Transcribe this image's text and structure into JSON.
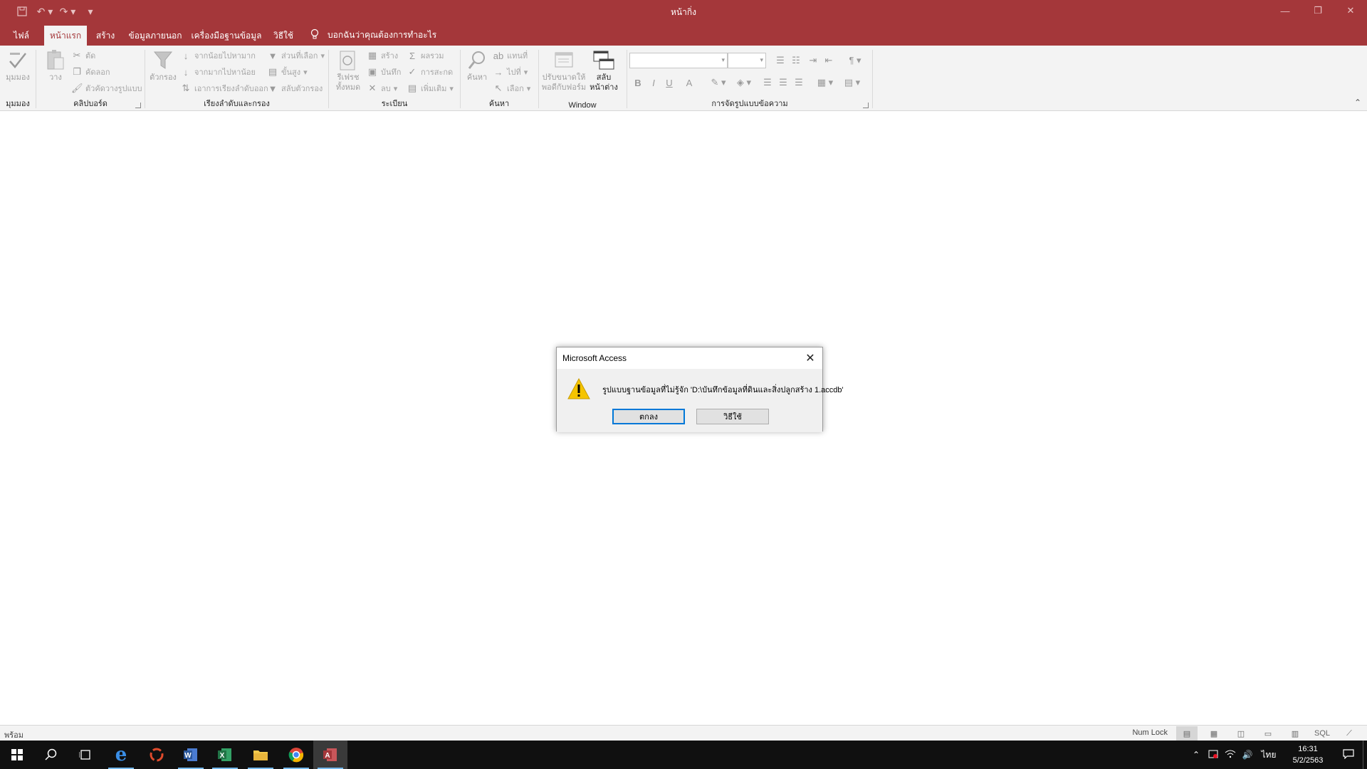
{
  "window": {
    "title": "หน้ากิ่ง",
    "quick_access": [
      "save-icon",
      "undo-icon",
      "redo-icon",
      "customize-icon"
    ],
    "controls": [
      "minimize-icon",
      "restore-icon",
      "close-icon"
    ]
  },
  "tabs": [
    {
      "label": "ไฟล์"
    },
    {
      "label": "หน้าแรก"
    },
    {
      "label": "สร้าง"
    },
    {
      "label": "ข้อมูลภายนอก"
    },
    {
      "label": "เครื่องมือฐานข้อมูล"
    },
    {
      "label": "วิธีใช้"
    }
  ],
  "tell_me": "บอกฉันว่าคุณต้องการทำอะไร",
  "ribbon": {
    "views": {
      "group": "มุมมอง",
      "view_label": "มุมมอง"
    },
    "clipboard": {
      "group": "คลิปบอร์ด",
      "paste": "วาง",
      "cut": "ตัด",
      "copy": "คัดลอก",
      "format_painter": "ตัวคัดวางรูปแบบ"
    },
    "sort_filter": {
      "group": "เรียงลำดับและกรอง",
      "filter": "ตัวกรอง",
      "ascending": "จากน้อยไปหามาก",
      "descending": "จากมากไปหาน้อย",
      "remove_sort": "เอาการเรียงลำดับออก",
      "selection": "ส่วนที่เลือก",
      "advanced": "ขั้นสูง",
      "toggle_filter": "สลับตัวกรอง"
    },
    "records": {
      "group": "ระเบียน",
      "refresh": "รีเฟรชทั้งหมด",
      "new": "สร้าง",
      "save": "บันทึก",
      "delete": "ลบ",
      "totals": "ผลรวม",
      "spelling": "การสะกด",
      "more": "เพิ่มเติม"
    },
    "find": {
      "group": "ค้นหา",
      "find": "ค้นหา",
      "replace": "แทนที่",
      "goto": "ไปที่",
      "select": "เลือก"
    },
    "window": {
      "group": "Window",
      "fit": "ปรับขนาดให้พอดีกับฟอร์ม",
      "switch": "สลับหน้าต่าง"
    },
    "text_format": {
      "group": "การจัดรูปแบบข้อความ",
      "bold": "B",
      "italic": "I",
      "underline": "U",
      "font_color": "A"
    }
  },
  "dialog": {
    "title": "Microsoft Access",
    "message": "รูปแบบฐานข้อมูลที่ไม่รู้จัก 'D:\\บันทึกข้อมูลที่ดินและสิ่งปลูกสร้าง 1.accdb'",
    "ok": "ตกลง",
    "help": "วิธีใช้",
    "warning_color": "#f5c400"
  },
  "status": {
    "left": "พร้อม",
    "numlock": "Num Lock",
    "view_icons": [
      "datasheet-view-icon",
      "pivot-table-icon",
      "form-view-icon",
      "layout-view-icon",
      "design-view-icon",
      "sql-view-icon",
      "pivot-chart-icon"
    ],
    "sql_label": "SQL"
  },
  "taskbar": {
    "apps": [
      "start-icon",
      "search-icon",
      "task-view-icon",
      "edge-icon",
      "recovery-app-icon",
      "word-icon",
      "excel-icon",
      "file-explorer-icon",
      "chrome-icon",
      "access-icon"
    ],
    "lang": "ไทย",
    "time": "16:31",
    "date": "5/2/2563"
  },
  "colors": {
    "accent": "#a4373a",
    "ribbon": "#f3f3f3",
    "taskbar": "#101010",
    "focus": "#0078d7"
  }
}
